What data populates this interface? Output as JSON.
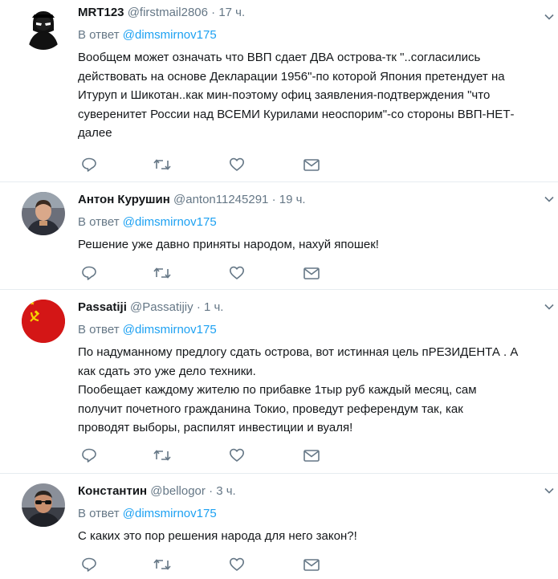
{
  "tweets": [
    {
      "name": "MRT123",
      "handle": "@firstmail2806",
      "dot": "·",
      "time": "17 ч.",
      "reply_prefix": "В ответ",
      "reply_to": "@dimsmirnov175",
      "text": "Вообщем может означать что ВВП сдает ДВА острова-тк \"..согласились\nдействовать на основе Декларации 1956\"-по которой Япония претендует на\nИтуруп и Шикотан..как мин-поэтому офиц заявления-подтверждения \"что\nсуверенитет России над ВСЕМИ Курилами неоспорим\"-со стороны ВВП-НЕТ-\nдалее",
      "avatar": "hooded-figure"
    },
    {
      "name": "Антон Курушин",
      "handle": "@anton11245291",
      "dot": "·",
      "time": "19 ч.",
      "reply_prefix": "В ответ",
      "reply_to": "@dimsmirnov175",
      "text": "Решение уже давно приняты народом, нахуй япошек!",
      "avatar": "man-photo"
    },
    {
      "name": "Passatiji",
      "handle": "@Passatijiy",
      "dot": "·",
      "time": "1 ч.",
      "reply_prefix": "В ответ",
      "reply_to": "@dimsmirnov175",
      "text": "По надуманному предлогу сдать острова, вот истинная цель пРЕЗИДЕНТА . А\nкак сдать это уже дело техники.\nПообещает каждому жителю по прибавке 1тыр руб каждый месяц,  сам\nполучит почетного гражданина Токио, проведут референдум так, как\nпроводят выборы, распилят инвестиции и вуаля!",
      "avatar": "hammer-sickle-flag"
    },
    {
      "name": "Константин",
      "handle": "@bellogor",
      "dot": "·",
      "time": "3 ч.",
      "reply_prefix": "В ответ",
      "reply_to": "@dimsmirnov175",
      "text": "С каких это пор решения народа для него закон?!",
      "avatar": "man-sunglasses-photo"
    }
  ],
  "icons": {
    "reply": "reply-icon",
    "retweet": "retweet-icon",
    "like": "heart-icon",
    "message": "envelope-icon",
    "more": "chevron-down-icon"
  },
  "colors": {
    "link": "#1da1f2",
    "secondary": "#657786",
    "icon": "#657786",
    "border": "#e6ecf0"
  }
}
